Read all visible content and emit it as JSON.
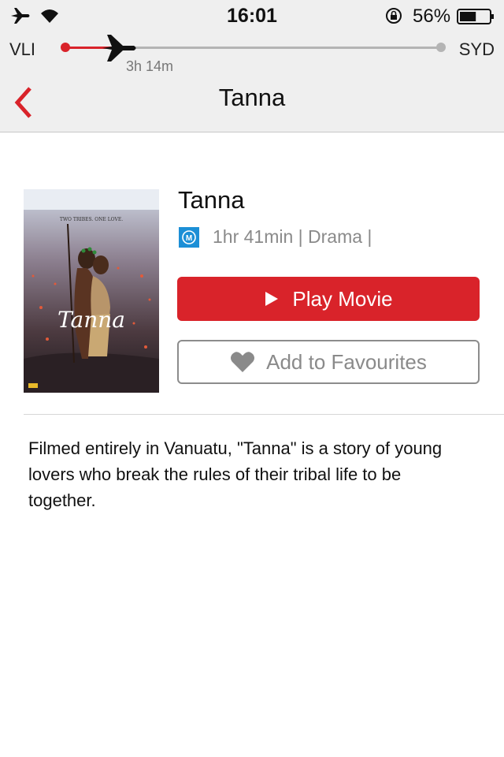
{
  "status_bar": {
    "time": "16:01",
    "battery_percent": "56%",
    "battery_level": 0.56
  },
  "flight": {
    "origin": "VLI",
    "destination": "SYD",
    "time_remaining": "3h 14m",
    "progress": 0.14
  },
  "nav": {
    "title": "Tanna"
  },
  "movie": {
    "title": "Tanna",
    "rating_label": "M",
    "meta": "1hr 41min | Drama |",
    "poster_tagline": "TWO TRIBES. ONE LOVE.",
    "poster_title": "Tanna",
    "play_label": "Play Movie",
    "favourite_label": "Add to Favourites",
    "description": "Filmed entirely in Vanuatu, \"Tanna\" is a story of young lovers who break the rules of their tribal life to be together."
  },
  "colors": {
    "accent": "#d9232a",
    "rating_badge": "#1c8fd6",
    "header_bg": "#efefef",
    "muted_text": "#8a8a8a"
  },
  "icons": {
    "status_left": [
      "airplane-icon",
      "wifi-icon"
    ],
    "status_right": [
      "rotation-lock-icon",
      "battery-icon"
    ],
    "flight": "airplane-icon",
    "nav_back": "chevron-left-icon",
    "play": "play-icon",
    "favourite": "heart-icon"
  }
}
